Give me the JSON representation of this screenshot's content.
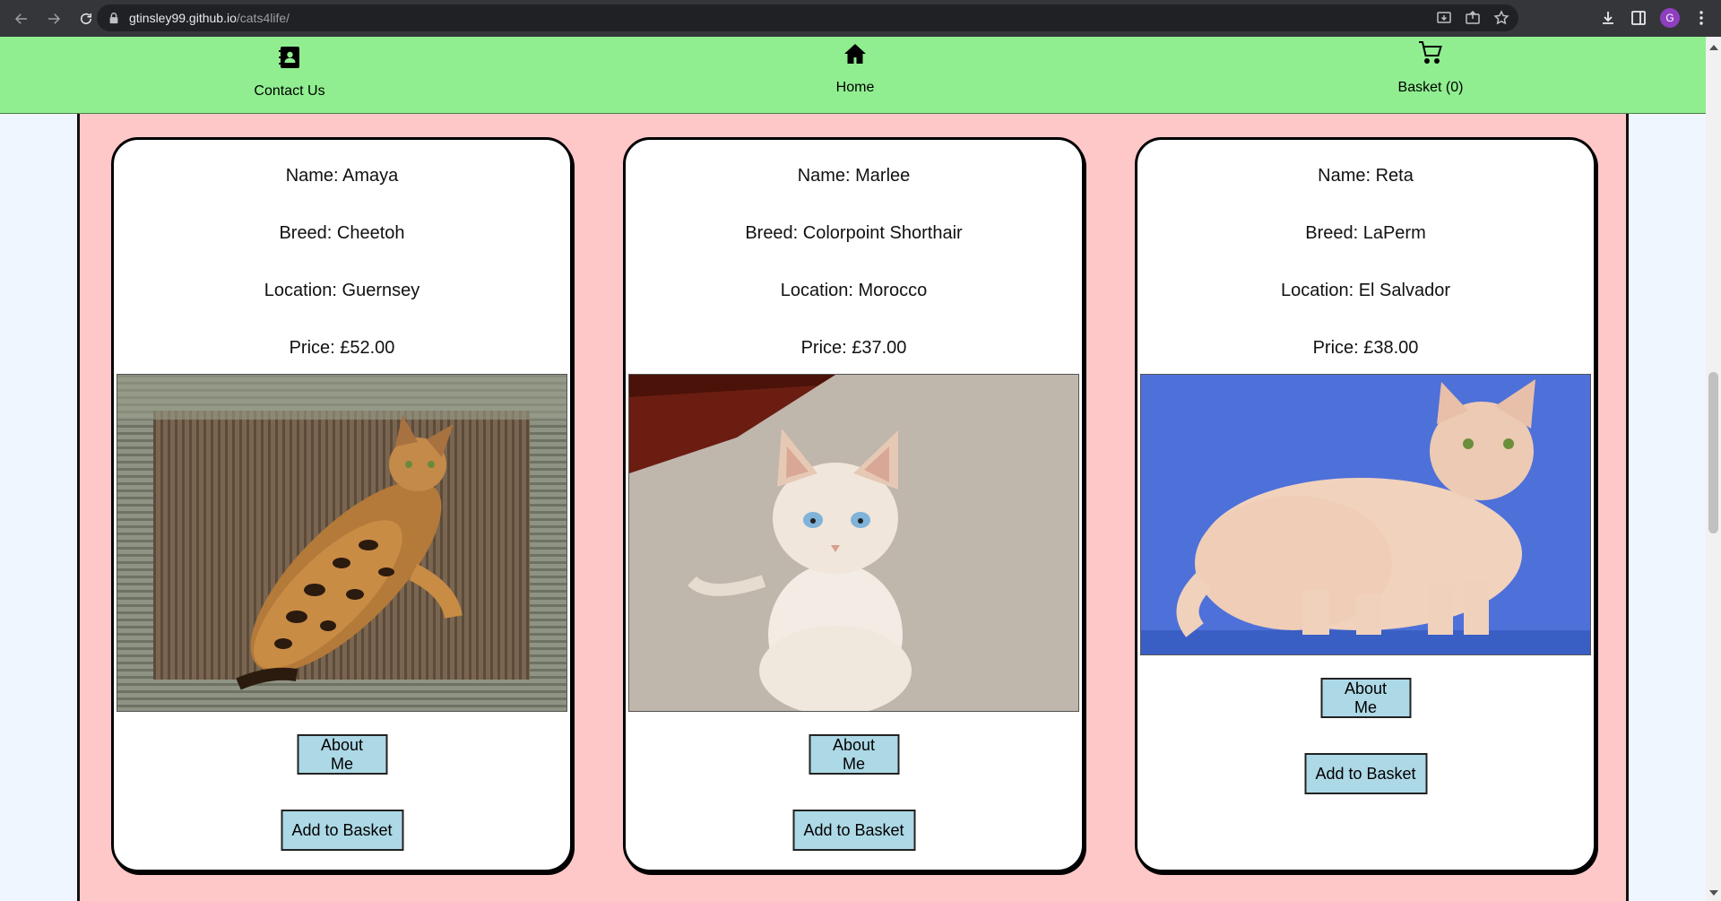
{
  "browser": {
    "url_host": "gtinsley99.github.io",
    "url_path": "/cats4life/",
    "avatar_letter": "G"
  },
  "nav": {
    "contact_label": "Contact Us",
    "home_label": "Home",
    "basket_label": "Basket (0)"
  },
  "cards": [
    {
      "name": "Name: Amaya",
      "breed": "Breed: Cheetoh",
      "location": "Location: Guernsey",
      "price": "Price: £52.00",
      "about_label": "About Me",
      "add_label": "Add to Basket"
    },
    {
      "name": "Name: Marlee",
      "breed": "Breed: Colorpoint Shorthair",
      "location": "Location: Morocco",
      "price": "Price: £37.00",
      "about_label": "About Me",
      "add_label": "Add to Basket"
    },
    {
      "name": "Name: Reta",
      "breed": "Breed: LaPerm",
      "location": "Location: El Salvador",
      "price": "Price: £38.00",
      "about_label": "About Me",
      "add_label": "Add to Basket"
    }
  ],
  "colors": {
    "nav_bg": "#90ee90",
    "content_bg": "#ffc8c8",
    "button_bg": "#add8e6"
  }
}
